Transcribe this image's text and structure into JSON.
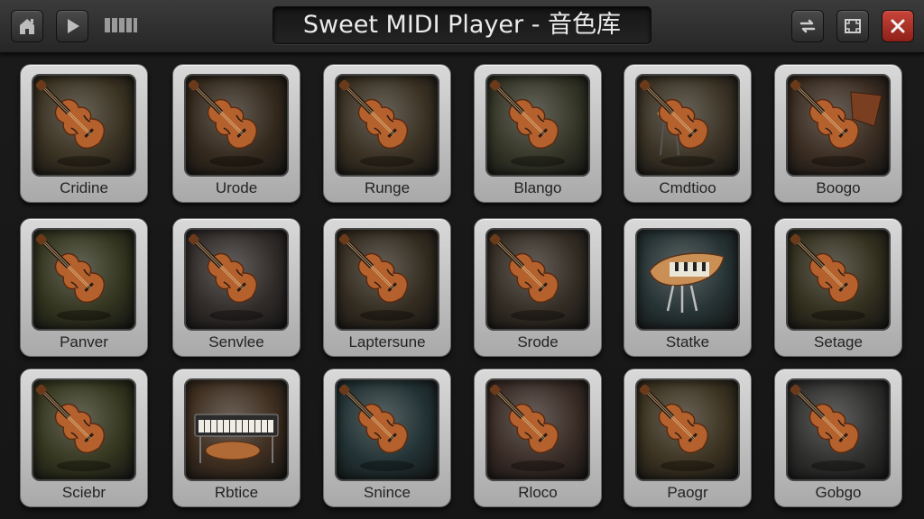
{
  "window": {
    "title": "Sweet MIDI Player - 音色库",
    "buttons": {
      "home": "home-icon",
      "play": "play-icon",
      "keys": "piano-keys-icon",
      "swap": "swap-icon",
      "fullscreen": "fullscreen-icon",
      "close": "close-icon"
    },
    "accent": "#b5322a"
  },
  "instruments": [
    {
      "label": "Cridine",
      "icon": "violin-icon",
      "bg": "#3a3222"
    },
    {
      "label": "Urode",
      "icon": "violin-icon",
      "bg": "#34291d"
    },
    {
      "label": "Runge",
      "icon": "violin-icon",
      "bg": "#3a3123"
    },
    {
      "label": "Blango",
      "icon": "violin-icon",
      "bg": "#353627"
    },
    {
      "label": "Cmdtioo",
      "icon": "violin-drum-icon",
      "bg": "#3b3325"
    },
    {
      "label": "Boogo",
      "icon": "violin-stand-icon",
      "bg": "#3b2d22"
    },
    {
      "label": "Panver",
      "icon": "violin-icon",
      "bg": "#33351f"
    },
    {
      "label": "Senvlee",
      "icon": "violin-icon",
      "bg": "#312c2a"
    },
    {
      "label": "Laptersune",
      "icon": "violin-icon",
      "bg": "#342c20"
    },
    {
      "label": "Srode",
      "icon": "violin-icon",
      "bg": "#342d24"
    },
    {
      "label": "Statke",
      "icon": "harp-icon",
      "bg": "#263334"
    },
    {
      "label": "Setage",
      "icon": "violin-icon",
      "bg": "#33301f"
    },
    {
      "label": "Sciebr",
      "icon": "violin-icon",
      "bg": "#35371f"
    },
    {
      "label": "Rbtice",
      "icon": "keyboard-icon",
      "bg": "#3e2e20"
    },
    {
      "label": "Snince",
      "icon": "violin-icon",
      "bg": "#223234"
    },
    {
      "label": "Rloco",
      "icon": "violin-icon",
      "bg": "#3a2c26"
    },
    {
      "label": "Paogr",
      "icon": "violin-icon",
      "bg": "#3c3321"
    },
    {
      "label": "Gobgo",
      "icon": "violin-icon",
      "bg": "#2f2f2e"
    }
  ]
}
